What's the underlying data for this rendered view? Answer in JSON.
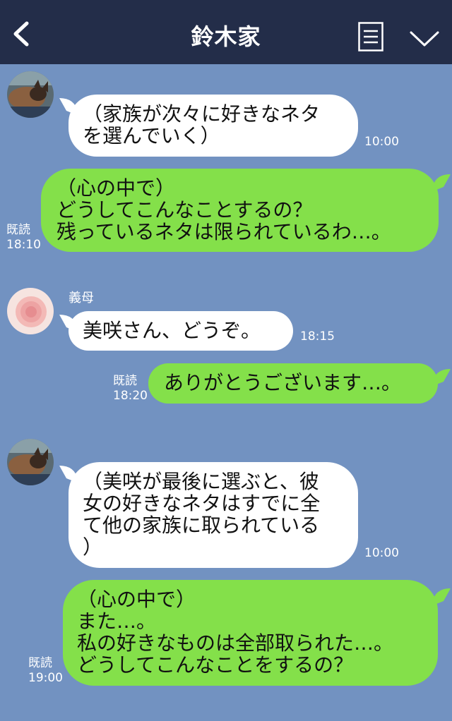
{
  "header": {
    "title": "鈴木家"
  },
  "messages": [
    {
      "text": "（家族が次々に好きなネタ\nを選んでいく）",
      "time": "10:00"
    },
    {
      "text": "（心の中で）\nどうしてこんなことするの？\n残っているネタは限られているわ…。",
      "read": "既読",
      "time": "18:10"
    },
    {
      "sender": "義母",
      "text": "美咲さん、どうぞ。",
      "time": "18:15"
    },
    {
      "text": "ありがとうございます…。",
      "read": "既読",
      "time": "18:20"
    },
    {
      "text": "（美咲が最後に選ぶと、彼\n女の好きなネタはすでに全\nて他の家族に取られている\n）",
      "time": "10:00"
    },
    {
      "text": "（心の中で）\nまた…。\n私の好きなものは全部取られた…。\nどうしてこんなことをするの？",
      "read": "既読",
      "time": "19:00"
    }
  ],
  "colors": {
    "header": "#232d49",
    "background": "#7292c1",
    "own_bubble": "#84e04a",
    "other_bubble": "#ffffff"
  }
}
